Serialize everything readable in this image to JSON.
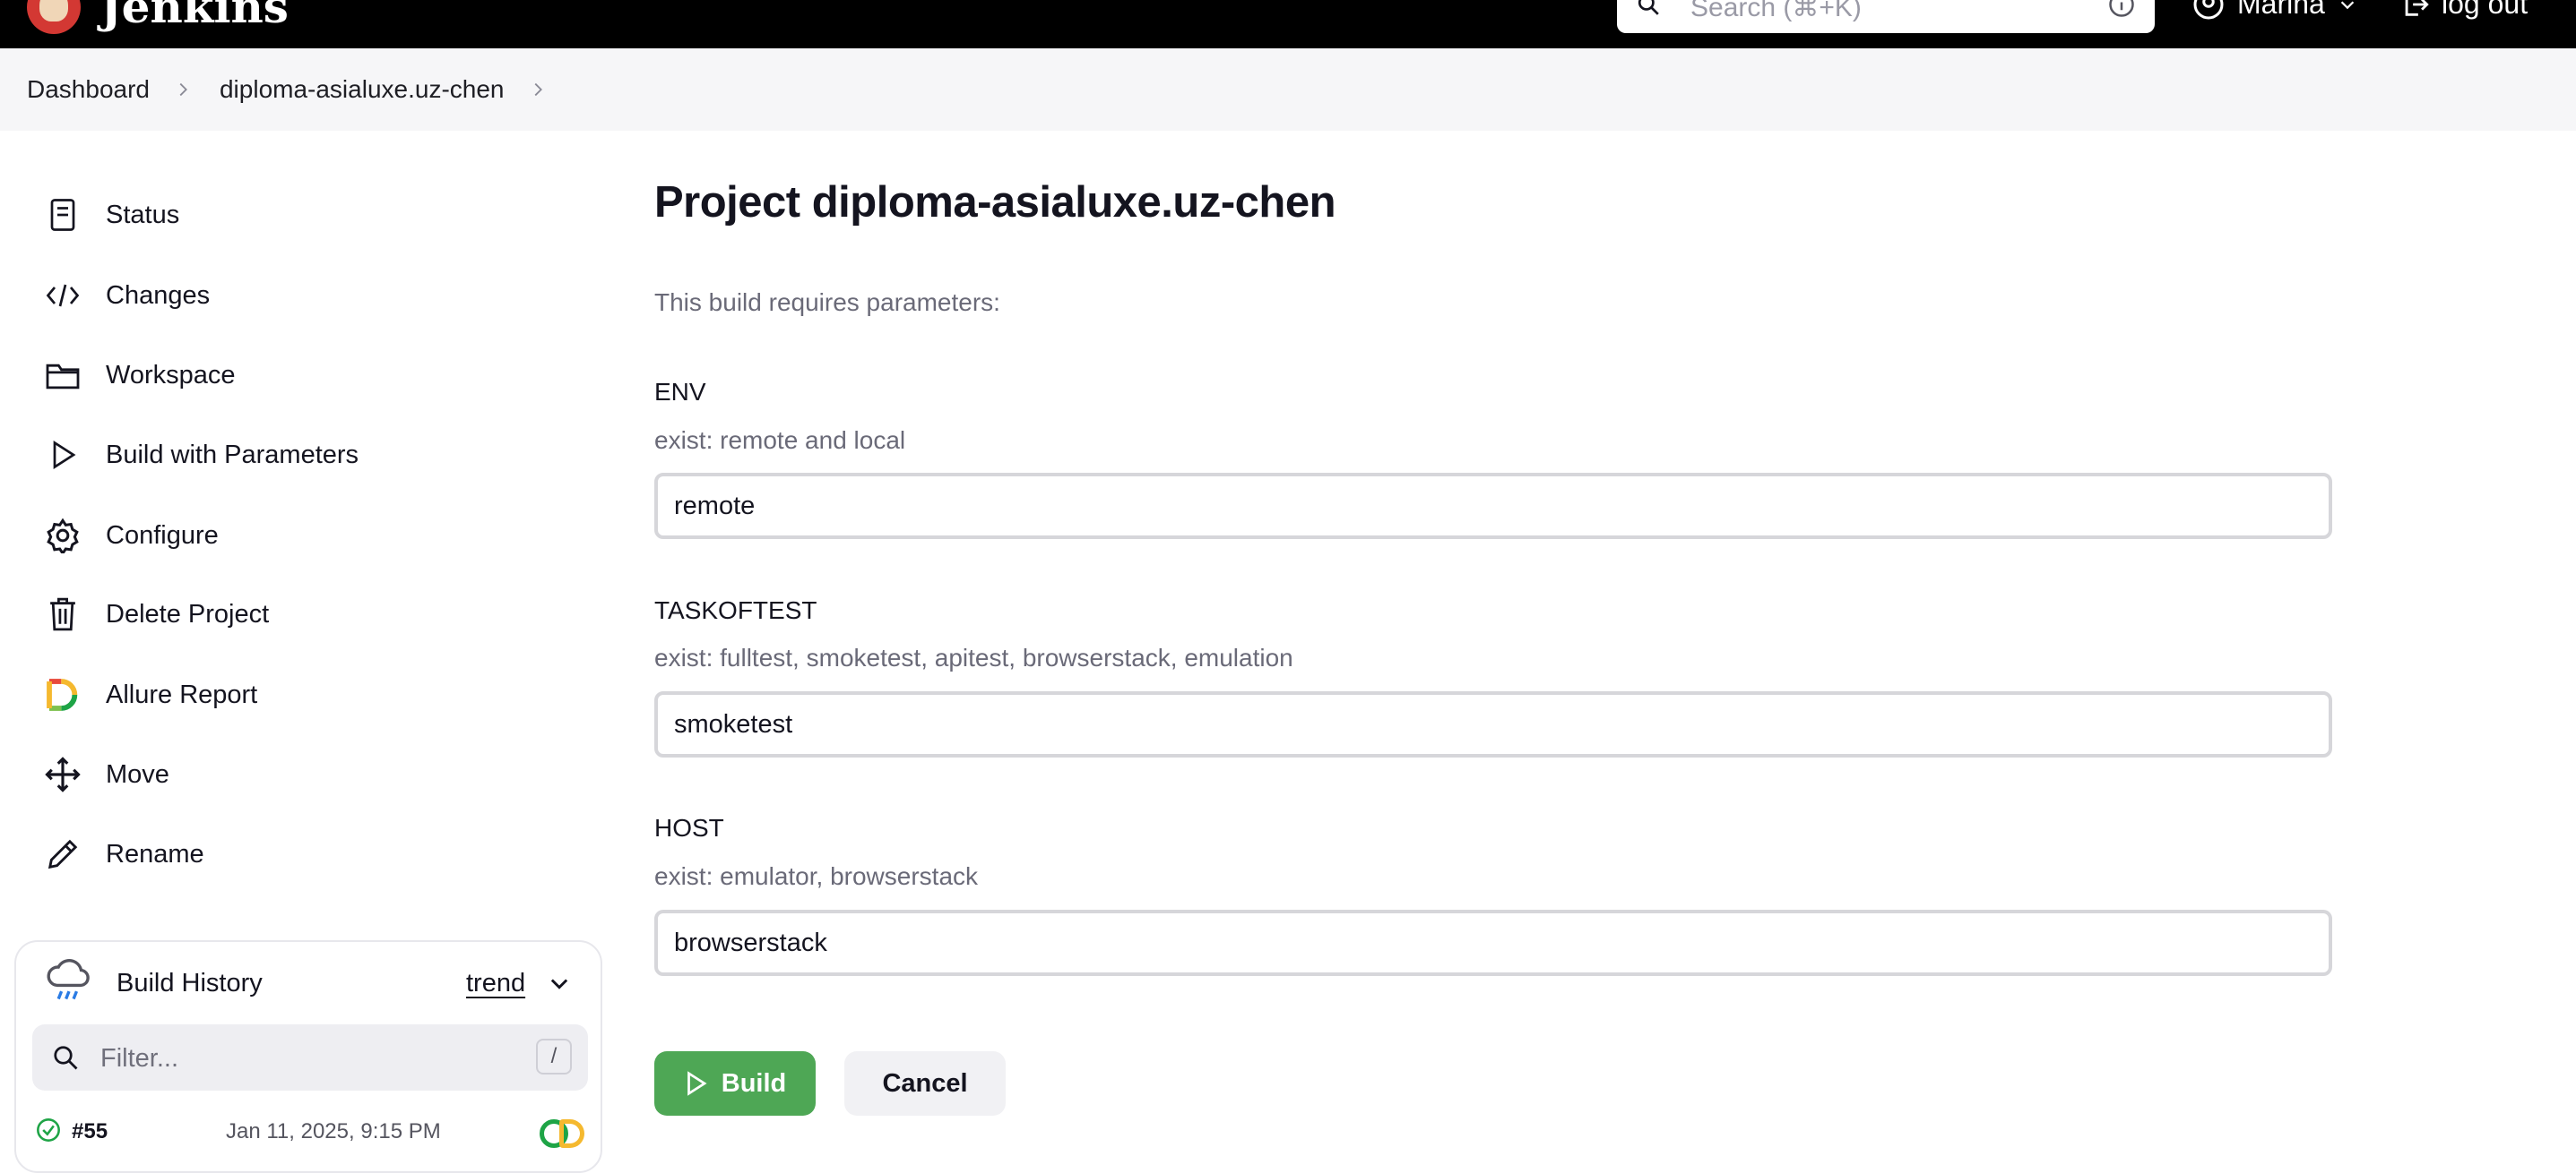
{
  "header": {
    "app_name": "Jenkins",
    "search_placeholder": "Search (⌘+K)",
    "user_name": "Marina",
    "logout_label": "log out"
  },
  "breadcrumb": {
    "items": [
      "Dashboard",
      "diploma-asialuxe.uz-chen"
    ]
  },
  "sidebar": {
    "items": [
      {
        "label": "Status",
        "icon": "status-icon"
      },
      {
        "label": "Changes",
        "icon": "code-icon"
      },
      {
        "label": "Workspace",
        "icon": "folder-icon"
      },
      {
        "label": "Build with Parameters",
        "icon": "play-icon"
      },
      {
        "label": "Configure",
        "icon": "gear-icon"
      },
      {
        "label": "Delete Project",
        "icon": "trash-icon"
      },
      {
        "label": "Allure Report",
        "icon": "allure-icon"
      },
      {
        "label": "Move",
        "icon": "move-icon"
      },
      {
        "label": "Rename",
        "icon": "pencil-icon"
      }
    ]
  },
  "build_history": {
    "title": "Build History",
    "trend_label": "trend",
    "filter_placeholder": "Filter...",
    "filter_shortcut": "/",
    "builds": [
      {
        "number": "#55",
        "date": "Jan 11, 2025, 9:15 PM"
      }
    ]
  },
  "main": {
    "title": "Project diploma-asialuxe.uz-chen",
    "intro": "This build requires parameters:",
    "params": [
      {
        "name": "ENV",
        "description": "exist: remote and local",
        "value": "remote"
      },
      {
        "name": "TASKOFTEST",
        "description": "exist: fulltest, smoketest, apitest, browserstack, emulation",
        "value": "smoketest"
      },
      {
        "name": "HOST",
        "description": "exist: emulator, browserstack",
        "value": "browserstack"
      }
    ],
    "build_label": "Build",
    "cancel_label": "Cancel"
  },
  "colors": {
    "header_bg": "#000000",
    "build_button": "#4ea755",
    "success": "#1ea446"
  }
}
